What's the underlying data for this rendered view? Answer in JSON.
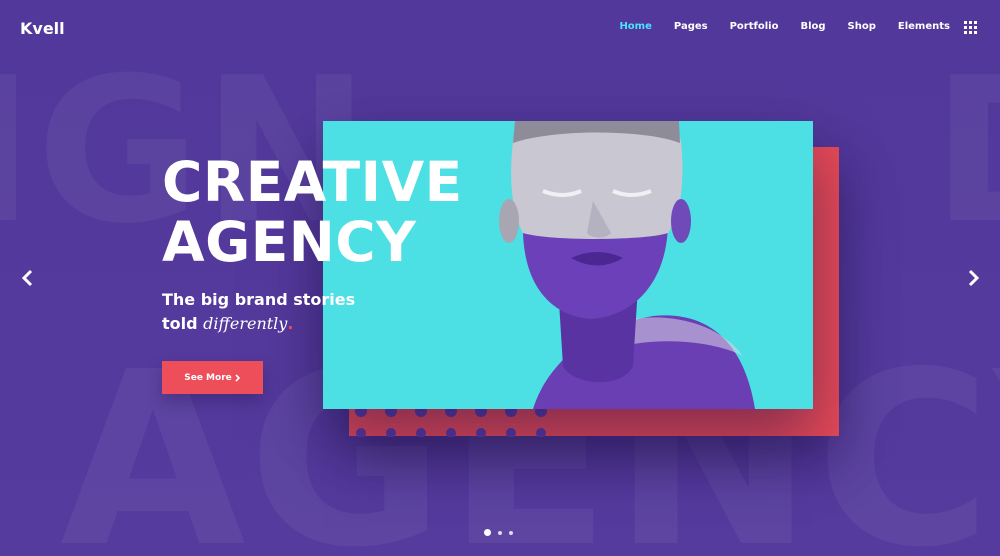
{
  "header": {
    "logo": "Kvell",
    "nav": [
      {
        "label": "Home",
        "active": true
      },
      {
        "label": "Pages",
        "active": false
      },
      {
        "label": "Portfolio",
        "active": false
      },
      {
        "label": "Blog",
        "active": false
      },
      {
        "label": "Shop",
        "active": false
      },
      {
        "label": "Elements",
        "active": false
      }
    ],
    "menu_icon": "grid-icon"
  },
  "hero": {
    "background_words": [
      "IGN",
      "AGENCY",
      "D"
    ],
    "headline_line1": "CREATIVE",
    "headline_line2": "AGENCY",
    "subline_line1": "The big brand stories",
    "subline_plain": "told",
    "subline_italic": "differently",
    "subline_dot": ".",
    "cta_label": "See More",
    "cta_icon": "chevron-right-icon",
    "prev_icon": "chevron-left-icon",
    "next_icon": "chevron-right-icon",
    "slides_total": 3,
    "slide_current": 1
  },
  "colors": {
    "background": "#53399a",
    "accent_red": "#ee4d5a",
    "accent_cyan": "#4cdfe3",
    "nav_active": "#4ee1ff"
  }
}
